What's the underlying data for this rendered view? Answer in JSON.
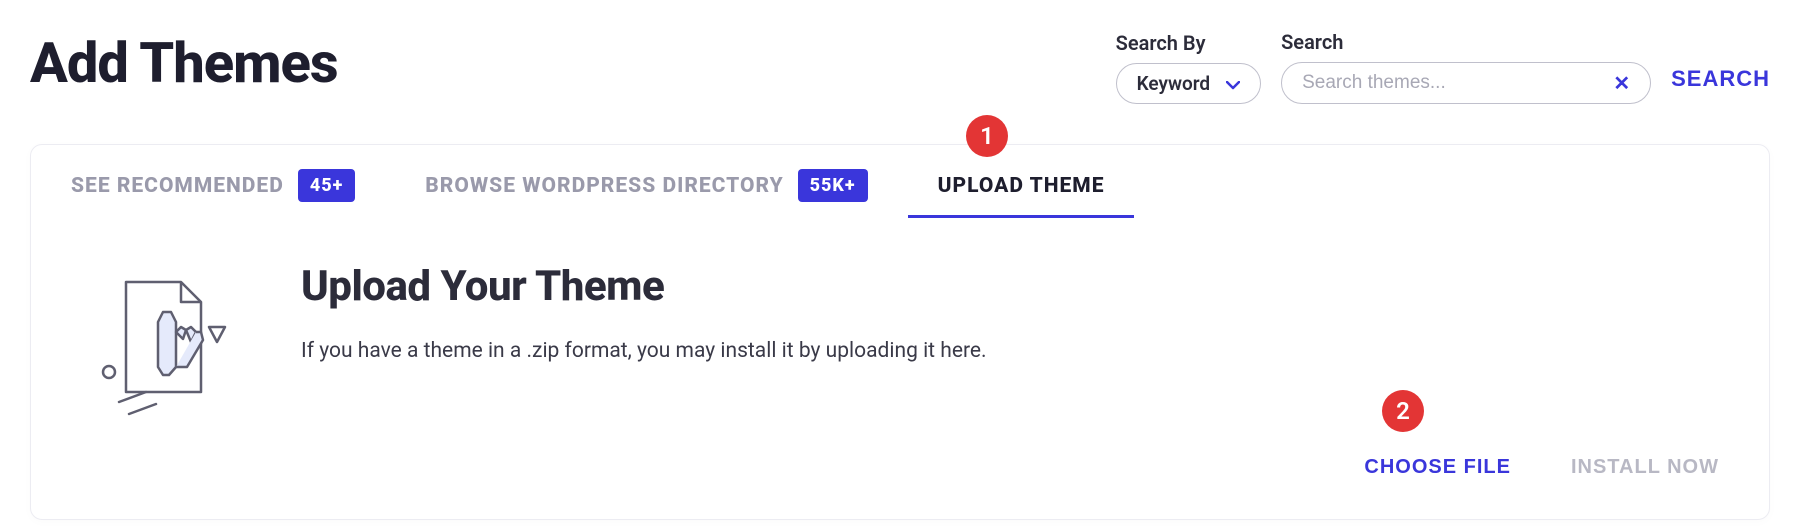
{
  "page_title": "Add Themes",
  "search": {
    "by_label": "Search By",
    "by_value": "Keyword",
    "label": "Search",
    "placeholder": "Search themes...",
    "button": "SEARCH"
  },
  "tabs": [
    {
      "label": "SEE RECOMMENDED",
      "badge": "45+",
      "active": false
    },
    {
      "label": "BROWSE WORDPRESS DIRECTORY",
      "badge": "55K+",
      "active": false
    },
    {
      "label": "UPLOAD THEME",
      "badge": null,
      "active": true
    }
  ],
  "upload": {
    "title": "Upload Your Theme",
    "description": "If you have a theme in a .zip format, you may install it by uploading it here.",
    "choose_file": "CHOOSE FILE",
    "install_now": "INSTALL NOW"
  },
  "annotations": {
    "1": "1",
    "2": "2"
  }
}
